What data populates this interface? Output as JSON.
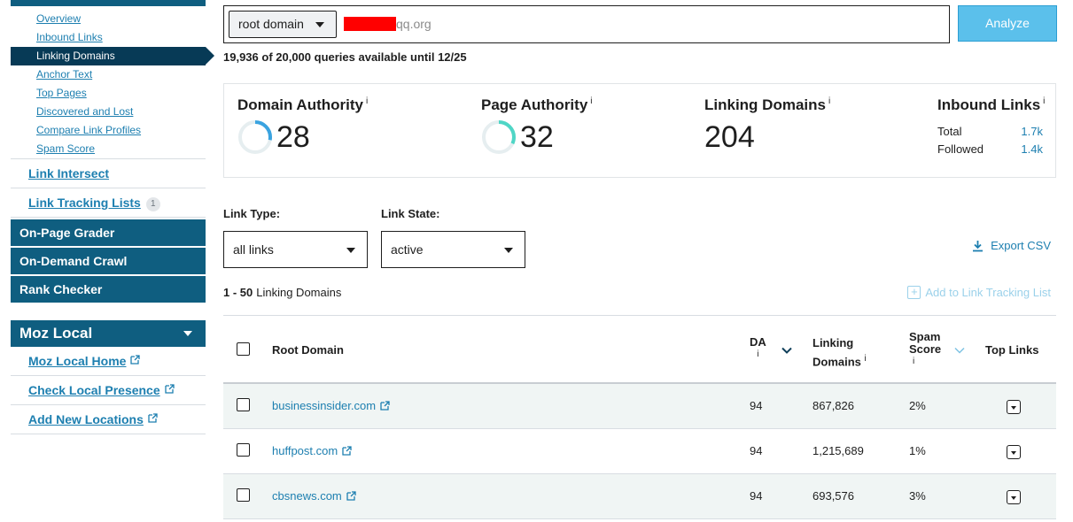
{
  "sidebar": {
    "sub_items": [
      {
        "label": "Overview",
        "active": false
      },
      {
        "label": "Inbound Links",
        "active": false
      },
      {
        "label": "Linking Domains",
        "active": true
      },
      {
        "label": "Anchor Text",
        "active": false
      },
      {
        "label": "Top Pages",
        "active": false
      },
      {
        "label": "Discovered and Lost",
        "active": false
      },
      {
        "label": "Compare Link Profiles",
        "active": false
      },
      {
        "label": "Spam Score",
        "active": false
      }
    ],
    "link_intersect": "Link Intersect",
    "link_tracking_lists": "Link Tracking Lists",
    "link_tracking_count": "1",
    "on_page_grader": "On-Page Grader",
    "on_demand_crawl": "On-Demand Crawl",
    "rank_checker": "Rank Checker",
    "moz_local": {
      "title": "Moz Local",
      "links": [
        "Moz Local Home",
        "Check Local Presence",
        "Add New Locations"
      ]
    }
  },
  "search": {
    "scope": "root domain",
    "value": "qq.org",
    "analyze_label": "Analyze",
    "queries_text": "19,936 of 20,000 queries available until 12/25"
  },
  "metrics": {
    "domain_authority": {
      "label": "Domain Authority",
      "value": "28",
      "fraction": 0.28
    },
    "page_authority": {
      "label": "Page Authority",
      "value": "32",
      "fraction": 0.32
    },
    "linking_domains": {
      "label": "Linking Domains",
      "value": "204"
    },
    "inbound_links": {
      "label": "Inbound Links",
      "total_label": "Total",
      "total_value": "1.7k",
      "followed_label": "Followed",
      "followed_value": "1.4k"
    },
    "info_mark": "i"
  },
  "filters": {
    "link_type_label": "Link Type:",
    "link_type_value": "all links",
    "link_state_label": "Link State:",
    "link_state_value": "active",
    "export_label": "Export CSV"
  },
  "list": {
    "range": "1 - 50",
    "range_label": "Linking Domains",
    "add_tracking_label": "Add to Link Tracking List"
  },
  "table": {
    "headers": {
      "root_domain": "Root Domain",
      "da": "DA",
      "linking_1": "Linking",
      "linking_2": "Domains",
      "spam_1": "Spam",
      "spam_2": "Score",
      "top_links": "Top Links"
    },
    "rows": [
      {
        "domain": "businessinsider.com",
        "da": "94",
        "linking_domains": "867,826",
        "spam": "2%"
      },
      {
        "domain": "huffpost.com",
        "da": "94",
        "linking_domains": "1,215,689",
        "spam": "1%"
      },
      {
        "domain": "cbsnews.com",
        "da": "94",
        "linking_domains": "693,576",
        "spam": "3%"
      }
    ]
  },
  "colors": {
    "nav_dark": "#0f5e80",
    "nav_active": "#073a56",
    "link_blue": "#1d7fb0",
    "analyze_bg": "#5bc0eb",
    "gauge_da": "#3aa3e0",
    "gauge_pa": "#4fd6c6",
    "row_alt": "#f0f5f4"
  }
}
